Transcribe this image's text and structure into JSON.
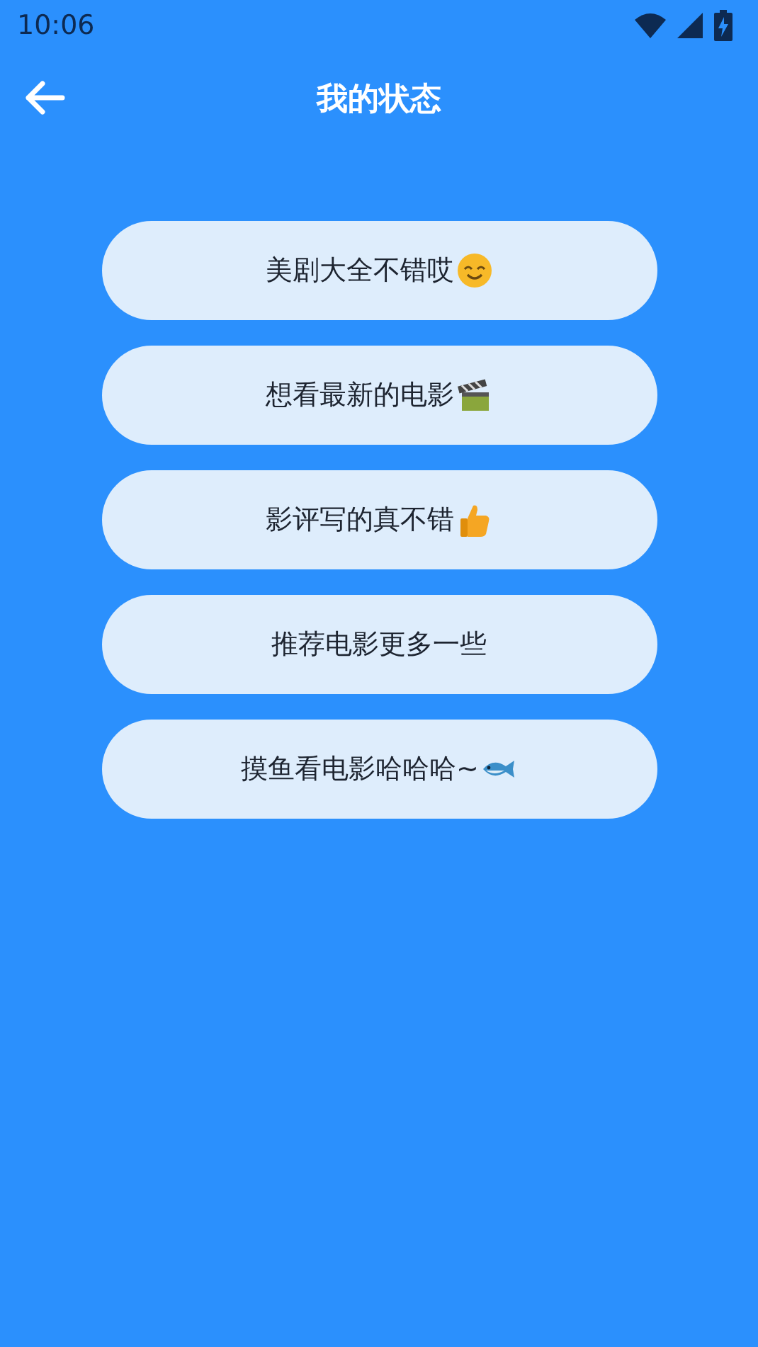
{
  "status_bar": {
    "time": "10:06"
  },
  "header": {
    "title": "我的状态"
  },
  "options": [
    {
      "label": "美剧大全不错哎",
      "kind": "smile"
    },
    {
      "label": "想看最新的电影",
      "kind": "clapper"
    },
    {
      "label": "影评写的真不错",
      "kind": "thumb"
    },
    {
      "label": "推荐电影更多一些",
      "kind": "plain"
    },
    {
      "label": "摸鱼看电影哈哈哈~",
      "kind": "fish"
    }
  ]
}
